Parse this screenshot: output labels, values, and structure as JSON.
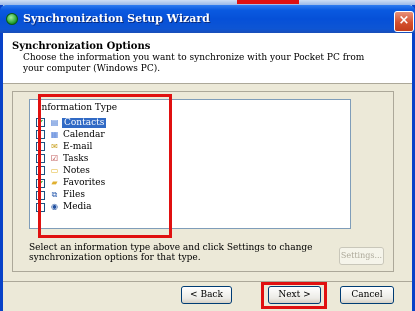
{
  "window": {
    "title": "Synchronization Setup Wizard",
    "close_glyph": "×"
  },
  "header": {
    "title": "Synchronization Options",
    "description": "Choose the information you want to synchronize with your Pocket PC from your computer (Windows PC)."
  },
  "list": {
    "header": "Information Type",
    "items": [
      {
        "label": "Contacts",
        "checked": true,
        "selected": true,
        "icon": "contacts-icon",
        "icon_glyph": "▤",
        "icon_color": "#3a6fd0"
      },
      {
        "label": "Calendar",
        "checked": false,
        "selected": false,
        "icon": "calendar-icon",
        "icon_glyph": "▦",
        "icon_color": "#4a7ad8"
      },
      {
        "label": "E-mail",
        "checked": false,
        "selected": false,
        "icon": "email-icon",
        "icon_glyph": "✉",
        "icon_color": "#c9a020"
      },
      {
        "label": "Tasks",
        "checked": false,
        "selected": false,
        "icon": "tasks-icon",
        "icon_glyph": "☑",
        "icon_color": "#b03030"
      },
      {
        "label": "Notes",
        "checked": false,
        "selected": false,
        "icon": "notes-icon",
        "icon_glyph": "▭",
        "icon_color": "#e0b020"
      },
      {
        "label": "Favorites",
        "checked": true,
        "selected": false,
        "icon": "favorites-icon",
        "icon_glyph": "▰",
        "icon_color": "#e0b030"
      },
      {
        "label": "Files",
        "checked": false,
        "selected": false,
        "icon": "files-icon",
        "icon_glyph": "⧉",
        "icon_color": "#3060b0"
      },
      {
        "label": "Media",
        "checked": false,
        "selected": false,
        "icon": "media-icon",
        "icon_glyph": "◉",
        "icon_color": "#2050a0"
      }
    ]
  },
  "hint": "Select an information type above and click Settings to change synchronization options for that type.",
  "buttons": {
    "settings": "Settings...",
    "back": "< Back",
    "next": "Next >",
    "cancel": "Cancel"
  },
  "check_glyph": "✔",
  "colors": {
    "titlebar": "#0650d8",
    "selection": "#316ac5",
    "annotation_red": "#e01010",
    "check_green": "#21a121"
  }
}
